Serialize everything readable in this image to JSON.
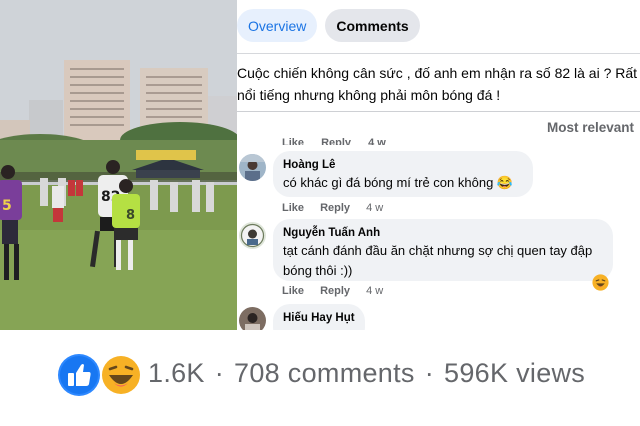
{
  "tabs": {
    "overview": "Overview",
    "comments": "Comments"
  },
  "post": {
    "text": "Cuộc chiến không cân sức , đố anh em nhận ra số 82 là ai ? Rất nổi tiếng nhưng không phải môn bóng đá !"
  },
  "sort": {
    "label": "Most relevant"
  },
  "photo": {
    "player_front_number": "82",
    "player_left_number": "5",
    "bib_number": "8"
  },
  "cut_comment_actions": {
    "like": "Like",
    "reply": "Reply",
    "time": "4 w"
  },
  "comments": [
    {
      "author": "Hoàng Lê",
      "text": "có khác gì đá bóng mí trẻ con không 😂",
      "like": "Like",
      "reply": "Reply",
      "time": "4 w",
      "reaction": ""
    },
    {
      "author": "Nguyễn Tuấn Anh",
      "text_line1": "tạt cánh đánh đầu ăn chặt nhưng sợ chị quen tay đập",
      "text_line2": "bóng thôi :))",
      "like": "Like",
      "reply": "Reply",
      "time": "4 w",
      "reaction": "haha-icon"
    },
    {
      "author": "Hiếu Hay Hụt",
      "text": ""
    }
  ],
  "stats": {
    "reactions_count": "1.6K",
    "comments": "708 comments",
    "views": "596K views",
    "separator": "·"
  },
  "colors": {
    "accent": "#1b74e4",
    "secondary_text": "#65676b",
    "bubble": "#f0f2f5"
  }
}
